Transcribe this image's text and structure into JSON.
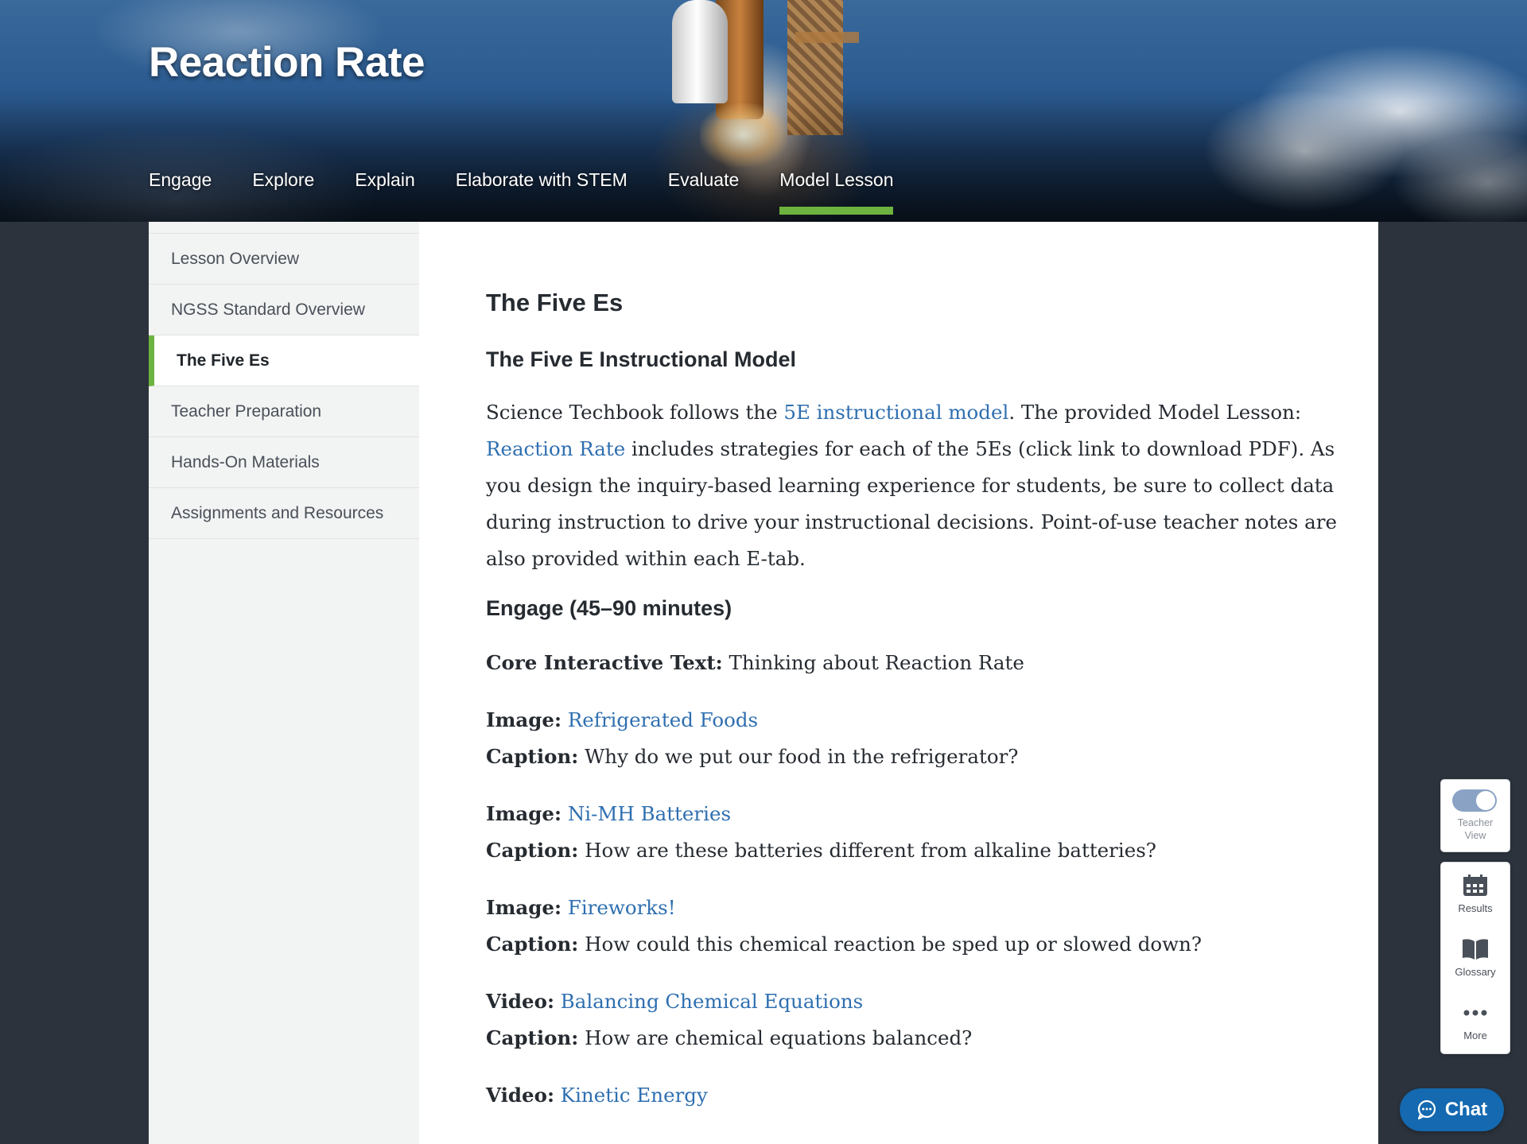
{
  "header": {
    "title": "Reaction Rate",
    "tabs": [
      {
        "label": "Engage",
        "active": false
      },
      {
        "label": "Explore",
        "active": false
      },
      {
        "label": "Explain",
        "active": false
      },
      {
        "label": "Elaborate with STEM",
        "active": false
      },
      {
        "label": "Evaluate",
        "active": false
      },
      {
        "label": "Model Lesson",
        "active": true
      }
    ],
    "accent_color": "#6db33f"
  },
  "sidebar": {
    "items": [
      {
        "label": "Lesson Overview",
        "active": false
      },
      {
        "label": "NGSS Standard Overview",
        "active": false
      },
      {
        "label": "The Five Es",
        "active": true
      },
      {
        "label": "Teacher Preparation",
        "active": false
      },
      {
        "label": "Hands-On Materials",
        "active": false
      },
      {
        "label": "Assignments and Resources",
        "active": false
      }
    ]
  },
  "main": {
    "heading": "The Five Es",
    "subheading": "The Five E Instructional Model",
    "intro": {
      "t1": "Science Techbook follows the ",
      "link1": "5E instructional model",
      "t2": ". The provided Model Lesson: ",
      "link2": "Reaction Rate",
      "t3": " includes strategies for each of the 5Es (click link to download PDF). As you design the inquiry-based learning experience for students, be sure to collect data during instruction to drive your instructional decisions. Point-of-use teacher notes are also provided within each E-tab."
    },
    "engage_heading": "Engage (45–90 minutes)",
    "core_label": "Core Interactive Text:",
    "core_text": " Thinking about Reaction Rate",
    "resources": [
      {
        "type_label": "Image:",
        "title": "Refrigerated Foods",
        "caption_label": "Caption:",
        "caption": " Why do we put our food in the refrigerator?"
      },
      {
        "type_label": "Image:",
        "title": "Ni-MH Batteries",
        "caption_label": "Caption:",
        "caption": " How are these batteries different from alkaline batteries?"
      },
      {
        "type_label": "Image:",
        "title": "Fireworks!",
        "caption_label": "Caption:",
        "caption": " How could this chemical reaction be sped up or slowed down?"
      },
      {
        "type_label": "Video:",
        "title": "Balancing Chemical Equations",
        "caption_label": "Caption:",
        "caption": " How are chemical equations balanced?"
      },
      {
        "type_label": "Video:",
        "title": "Kinetic Energy"
      }
    ],
    "link_color": "#2f6fb0"
  },
  "tools": {
    "teacher_view_label_1": "Teacher",
    "teacher_view_label_2": "View",
    "teacher_view_on": true,
    "results_label": "Results",
    "glossary_label": "Glossary",
    "more_label": "More",
    "chat_label": "Chat"
  }
}
